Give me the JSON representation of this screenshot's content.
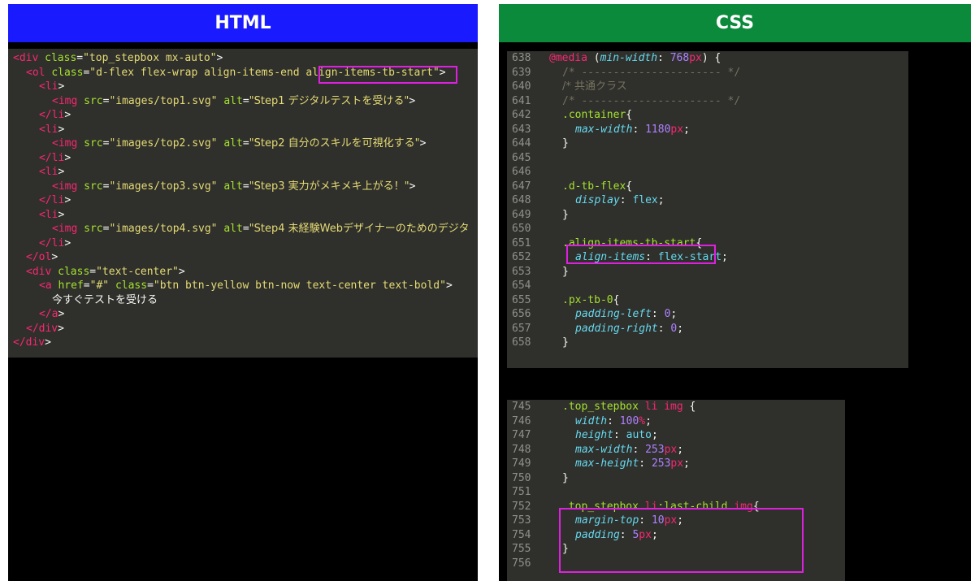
{
  "html_panel": {
    "title": "HTML",
    "lines": [
      {
        "indent": 0,
        "parts": [
          [
            "tag",
            "<div "
          ],
          [
            "attr",
            "class"
          ],
          [
            "punc",
            "="
          ],
          [
            "str",
            "\"top_stepbox mx-auto\""
          ],
          [
            "punc",
            ">"
          ]
        ]
      },
      {
        "indent": 1,
        "parts": [
          [
            "tag",
            "<ol "
          ],
          [
            "attr",
            "class"
          ],
          [
            "punc",
            "="
          ],
          [
            "str",
            "\"d-flex flex-wrap align-items-end align-items-tb-start\""
          ],
          [
            "punc",
            ">"
          ]
        ]
      },
      {
        "indent": 2,
        "parts": [
          [
            "tag",
            "<li"
          ],
          [
            "punc",
            ">"
          ]
        ]
      },
      {
        "indent": 3,
        "parts": [
          [
            "tag",
            "<img "
          ],
          [
            "attr",
            "src"
          ],
          [
            "punc",
            "="
          ],
          [
            "str",
            "\"images/top1.svg\" "
          ],
          [
            "attr",
            "alt"
          ],
          [
            "punc",
            "="
          ],
          [
            "str",
            "\"Step1 デジタルテストを受ける\""
          ],
          [
            "punc",
            ">"
          ]
        ]
      },
      {
        "indent": 2,
        "parts": [
          [
            "tag",
            "</li"
          ],
          [
            "punc",
            ">"
          ]
        ]
      },
      {
        "indent": 2,
        "parts": [
          [
            "tag",
            "<li"
          ],
          [
            "punc",
            ">"
          ]
        ]
      },
      {
        "indent": 3,
        "parts": [
          [
            "tag",
            "<img "
          ],
          [
            "attr",
            "src"
          ],
          [
            "punc",
            "="
          ],
          [
            "str",
            "\"images/top2.svg\" "
          ],
          [
            "attr",
            "alt"
          ],
          [
            "punc",
            "="
          ],
          [
            "str",
            "\"Step2 自分のスキルを可視化する\""
          ],
          [
            "punc",
            ">"
          ]
        ]
      },
      {
        "indent": 2,
        "parts": [
          [
            "tag",
            "</li"
          ],
          [
            "punc",
            ">"
          ]
        ]
      },
      {
        "indent": 2,
        "parts": [
          [
            "tag",
            "<li"
          ],
          [
            "punc",
            ">"
          ]
        ]
      },
      {
        "indent": 3,
        "parts": [
          [
            "tag",
            "<img "
          ],
          [
            "attr",
            "src"
          ],
          [
            "punc",
            "="
          ],
          [
            "str",
            "\"images/top3.svg\" "
          ],
          [
            "attr",
            "alt"
          ],
          [
            "punc",
            "="
          ],
          [
            "str",
            "\"Step3 実力がメキメキ上がる！\""
          ],
          [
            "punc",
            ">"
          ]
        ]
      },
      {
        "indent": 2,
        "parts": [
          [
            "tag",
            "</li"
          ],
          [
            "punc",
            ">"
          ]
        ]
      },
      {
        "indent": 2,
        "parts": [
          [
            "tag",
            "<li"
          ],
          [
            "punc",
            ">"
          ]
        ]
      },
      {
        "indent": 3,
        "parts": [
          [
            "tag",
            "<img "
          ],
          [
            "attr",
            "src"
          ],
          [
            "punc",
            "="
          ],
          [
            "str",
            "\"images/top4.svg\" "
          ],
          [
            "attr",
            "alt"
          ],
          [
            "punc",
            "="
          ],
          [
            "str",
            "\"Step4 未経験Webデザイナーのためのデジタ"
          ]
        ]
      },
      {
        "indent": 2,
        "parts": [
          [
            "tag",
            "</li"
          ],
          [
            "punc",
            ">"
          ]
        ]
      },
      {
        "indent": 1,
        "parts": [
          [
            "tag",
            "</ol"
          ],
          [
            "punc",
            ">"
          ]
        ]
      },
      {
        "indent": 1,
        "parts": [
          [
            "tag",
            "<div "
          ],
          [
            "attr",
            "class"
          ],
          [
            "punc",
            "="
          ],
          [
            "str",
            "\"text-center\""
          ],
          [
            "punc",
            ">"
          ]
        ]
      },
      {
        "indent": 2,
        "parts": [
          [
            "tag",
            "<a "
          ],
          [
            "attr",
            "href"
          ],
          [
            "punc",
            "="
          ],
          [
            "str",
            "\"#\" "
          ],
          [
            "attr",
            "class"
          ],
          [
            "punc",
            "="
          ],
          [
            "str",
            "\"btn btn-yellow btn-now text-center text-bold\""
          ],
          [
            "punc",
            ">"
          ]
        ]
      },
      {
        "indent": 3,
        "parts": [
          [
            "punc",
            "今すぐテストを受ける"
          ]
        ]
      },
      {
        "indent": 2,
        "parts": [
          [
            "tag",
            "</a"
          ],
          [
            "punc",
            ">"
          ]
        ]
      },
      {
        "indent": 1,
        "parts": [
          [
            "tag",
            "</div"
          ],
          [
            "punc",
            ">"
          ]
        ]
      },
      {
        "indent": 0,
        "parts": [
          [
            "tag",
            "</div"
          ],
          [
            "punc",
            ">"
          ]
        ]
      }
    ]
  },
  "css_panel": {
    "title": "CSS",
    "block1": [
      {
        "n": "638",
        "indent": 0,
        "parts": [
          [
            "at",
            "@media"
          ],
          [
            "punc",
            " ("
          ],
          [
            "prop",
            "min-width"
          ],
          [
            "punc",
            ": "
          ],
          [
            "num",
            "768"
          ],
          [
            "unit",
            "px"
          ],
          [
            "punc",
            ") {"
          ]
        ]
      },
      {
        "n": "639",
        "indent": 1,
        "parts": [
          [
            "comment",
            "/* ---------------------- */"
          ]
        ]
      },
      {
        "n": "640",
        "indent": 1,
        "parts": [
          [
            "comment",
            "/* 共通クラス"
          ]
        ]
      },
      {
        "n": "641",
        "indent": 1,
        "parts": [
          [
            "comment",
            "/* ---------------------- */"
          ]
        ]
      },
      {
        "n": "642",
        "indent": 1,
        "parts": [
          [
            "sel",
            ".container"
          ],
          [
            "punc",
            "{"
          ]
        ]
      },
      {
        "n": "643",
        "indent": 2,
        "parts": [
          [
            "prop",
            "max-width"
          ],
          [
            "punc",
            ": "
          ],
          [
            "num",
            "1180"
          ],
          [
            "unit",
            "px"
          ],
          [
            "punc",
            ";"
          ]
        ]
      },
      {
        "n": "644",
        "indent": 1,
        "parts": [
          [
            "punc",
            "}"
          ]
        ]
      },
      {
        "n": "645",
        "indent": 0,
        "parts": []
      },
      {
        "n": "646",
        "indent": 0,
        "parts": []
      },
      {
        "n": "647",
        "indent": 1,
        "parts": [
          [
            "sel",
            ".d-tb-flex"
          ],
          [
            "punc",
            "{"
          ]
        ]
      },
      {
        "n": "648",
        "indent": 2,
        "parts": [
          [
            "prop",
            "display"
          ],
          [
            "punc",
            ": "
          ],
          [
            "kw",
            "flex"
          ],
          [
            "punc",
            ";"
          ]
        ]
      },
      {
        "n": "649",
        "indent": 1,
        "parts": [
          [
            "punc",
            "}"
          ]
        ]
      },
      {
        "n": "650",
        "indent": 0,
        "parts": []
      },
      {
        "n": "651",
        "indent": 1,
        "parts": [
          [
            "sel",
            ".align-items-tb-start"
          ],
          [
            "punc",
            "{"
          ]
        ]
      },
      {
        "n": "652",
        "indent": 2,
        "parts": [
          [
            "prop",
            "align-items"
          ],
          [
            "punc",
            ": "
          ],
          [
            "kw",
            "flex-start"
          ],
          [
            "punc",
            ";"
          ]
        ]
      },
      {
        "n": "653",
        "indent": 1,
        "parts": [
          [
            "punc",
            "}"
          ]
        ]
      },
      {
        "n": "654",
        "indent": 0,
        "parts": []
      },
      {
        "n": "655",
        "indent": 1,
        "parts": [
          [
            "sel",
            ".px-tb-0"
          ],
          [
            "punc",
            "{"
          ]
        ]
      },
      {
        "n": "656",
        "indent": 2,
        "parts": [
          [
            "prop",
            "padding-left"
          ],
          [
            "punc",
            ": "
          ],
          [
            "num",
            "0"
          ],
          [
            "punc",
            ";"
          ]
        ]
      },
      {
        "n": "657",
        "indent": 2,
        "parts": [
          [
            "prop",
            "padding-right"
          ],
          [
            "punc",
            ": "
          ],
          [
            "num",
            "0"
          ],
          [
            "punc",
            ";"
          ]
        ]
      },
      {
        "n": "658",
        "indent": 1,
        "parts": [
          [
            "punc",
            "}"
          ]
        ]
      }
    ],
    "block2": [
      {
        "n": "745",
        "indent": 1,
        "parts": [
          [
            "sel",
            ".top_stepbox "
          ],
          [
            "tag",
            "li"
          ],
          [
            "sel",
            " "
          ],
          [
            "tag",
            "img"
          ],
          [
            "punc",
            " {"
          ]
        ]
      },
      {
        "n": "746",
        "indent": 2,
        "parts": [
          [
            "prop",
            "width"
          ],
          [
            "punc",
            ": "
          ],
          [
            "num",
            "100"
          ],
          [
            "unit",
            "%"
          ],
          [
            "punc",
            ";"
          ]
        ]
      },
      {
        "n": "747",
        "indent": 2,
        "parts": [
          [
            "prop",
            "height"
          ],
          [
            "punc",
            ": "
          ],
          [
            "kw",
            "auto"
          ],
          [
            "punc",
            ";"
          ]
        ]
      },
      {
        "n": "748",
        "indent": 2,
        "parts": [
          [
            "prop",
            "max-width"
          ],
          [
            "punc",
            ": "
          ],
          [
            "num",
            "253"
          ],
          [
            "unit",
            "px"
          ],
          [
            "punc",
            ";"
          ]
        ]
      },
      {
        "n": "749",
        "indent": 2,
        "parts": [
          [
            "prop",
            "max-height"
          ],
          [
            "punc",
            ": "
          ],
          [
            "num",
            "253"
          ],
          [
            "unit",
            "px"
          ],
          [
            "punc",
            ";"
          ]
        ]
      },
      {
        "n": "750",
        "indent": 1,
        "parts": [
          [
            "punc",
            "}"
          ]
        ]
      },
      {
        "n": "751",
        "indent": 0,
        "parts": []
      },
      {
        "n": "752",
        "indent": 1,
        "parts": [
          [
            "sel",
            ".top_stepbox "
          ],
          [
            "tag",
            "li"
          ],
          [
            "sel",
            ":last-child "
          ],
          [
            "tag",
            "img"
          ],
          [
            "punc",
            "{"
          ]
        ]
      },
      {
        "n": "753",
        "indent": 2,
        "parts": [
          [
            "prop",
            "margin-top"
          ],
          [
            "punc",
            ": "
          ],
          [
            "num",
            "10"
          ],
          [
            "unit",
            "px"
          ],
          [
            "punc",
            ";"
          ]
        ]
      },
      {
        "n": "754",
        "indent": 2,
        "parts": [
          [
            "prop",
            "padding"
          ],
          [
            "punc",
            ": "
          ],
          [
            "num",
            "5"
          ],
          [
            "unit",
            "px"
          ],
          [
            "punc",
            ";"
          ]
        ]
      },
      {
        "n": "755",
        "indent": 1,
        "parts": [
          [
            "punc",
            "}"
          ]
        ]
      },
      {
        "n": "756",
        "indent": 0,
        "parts": []
      }
    ]
  },
  "highlight_color": "#e020e0"
}
